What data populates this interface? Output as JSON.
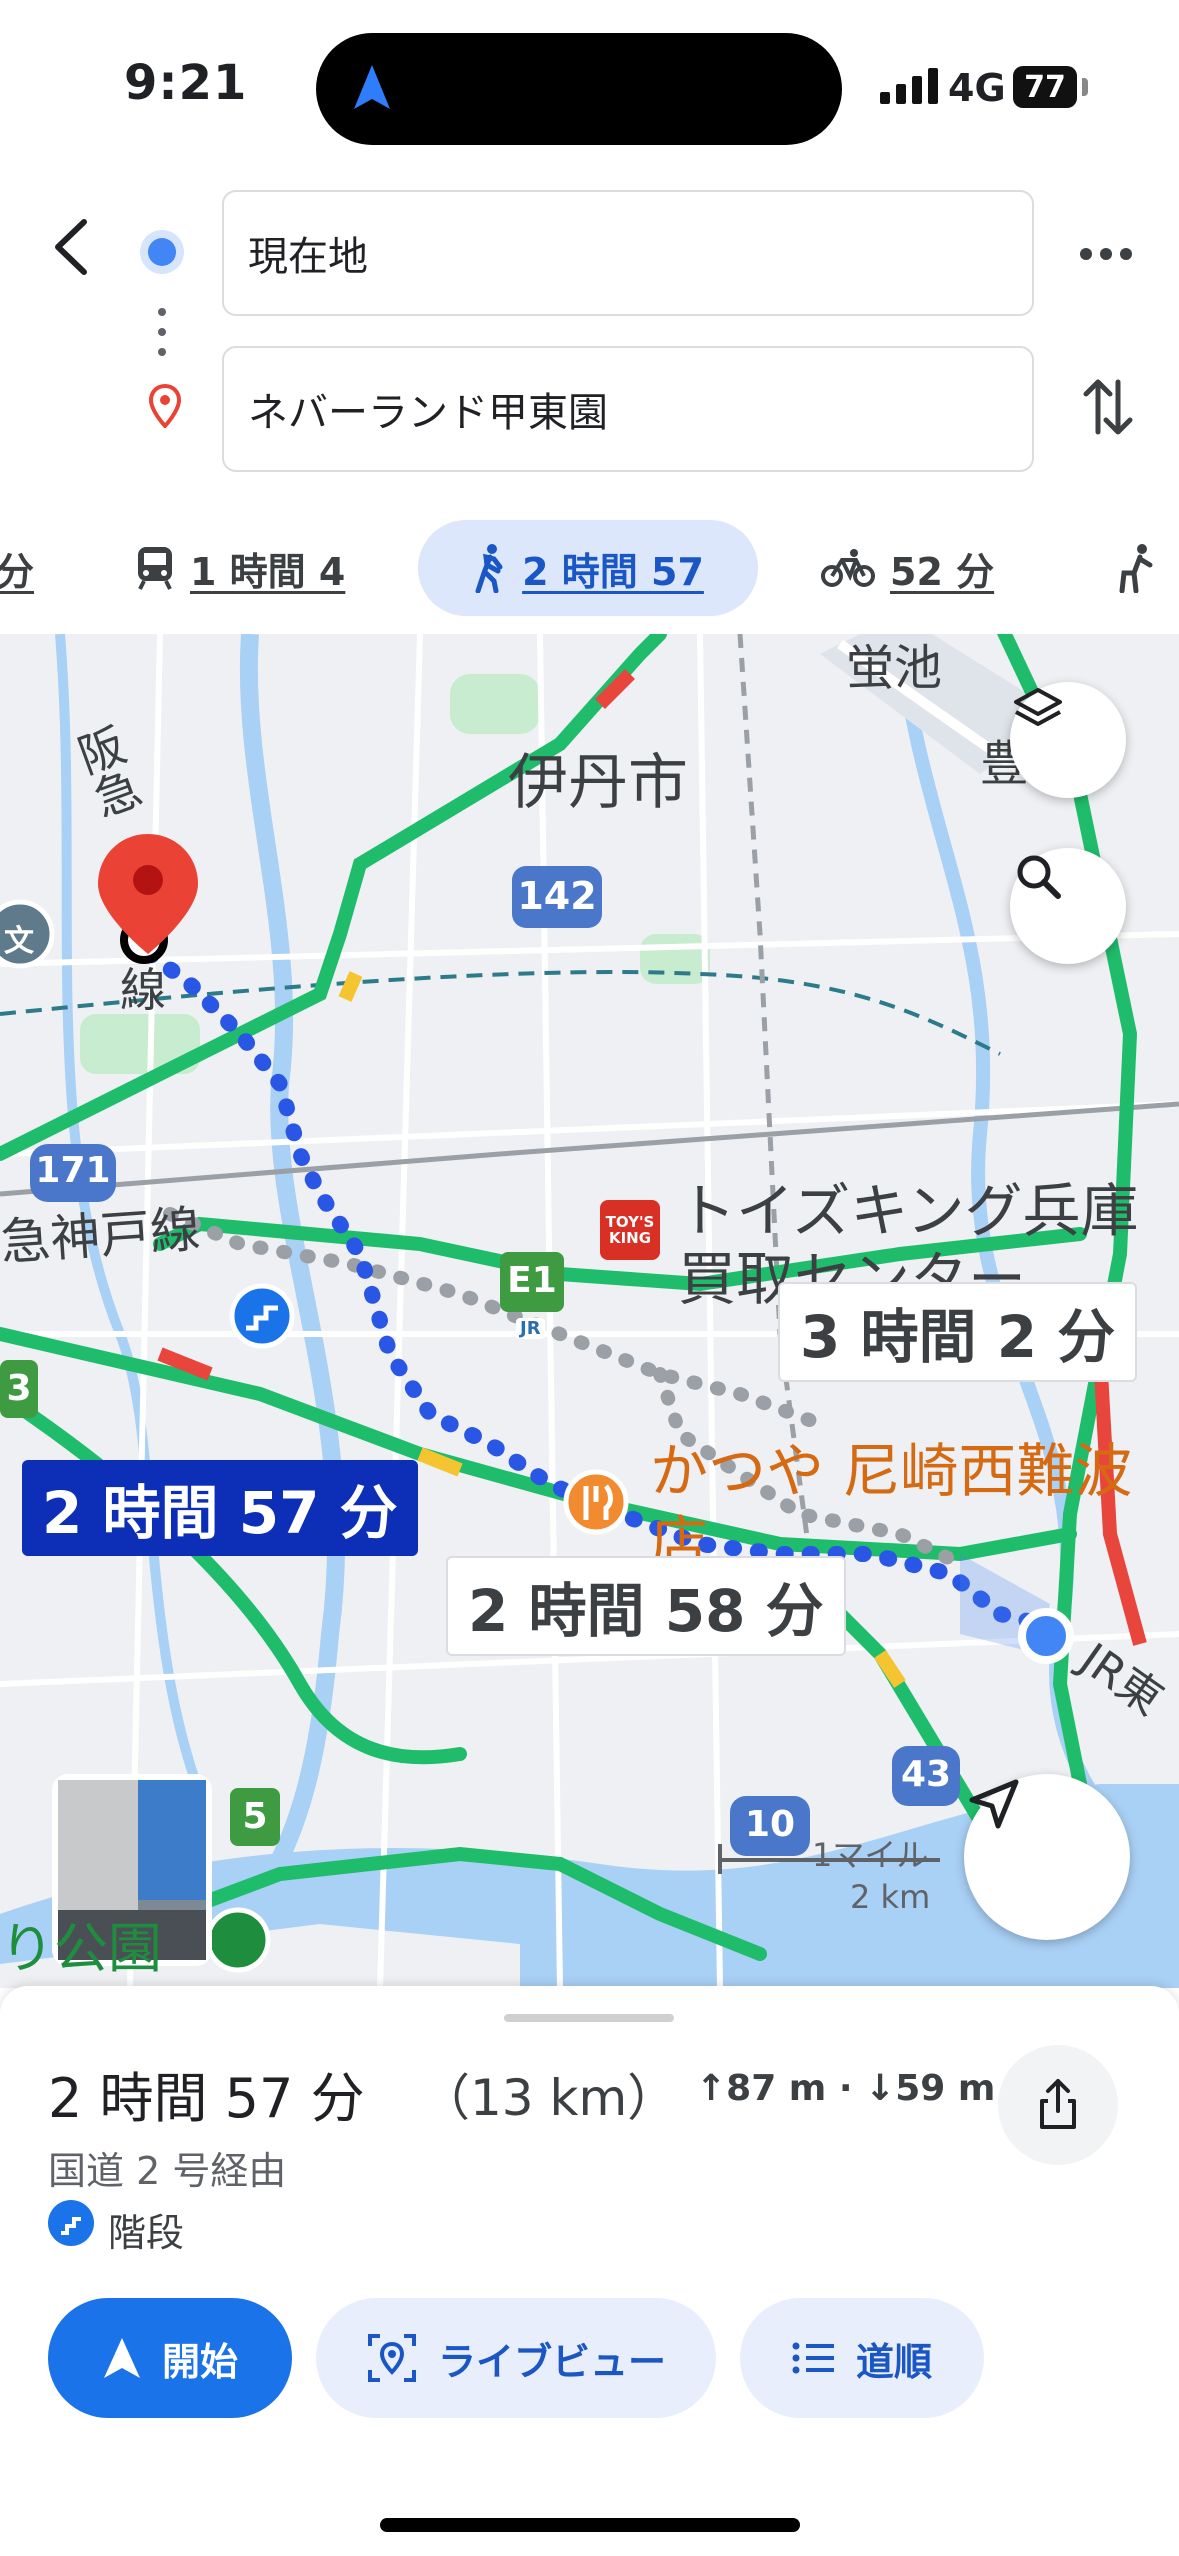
{
  "status": {
    "time": "9:21",
    "network": "4G",
    "battery": "77"
  },
  "header": {
    "origin": "現在地",
    "destination": "ネバーランド甲東園"
  },
  "tabs": [
    {
      "icon": "car-icon",
      "label": "分"
    },
    {
      "icon": "train-icon",
      "label": "1 時間 4"
    },
    {
      "icon": "walk-icon",
      "label": "2 時間 57",
      "selected": true
    },
    {
      "icon": "bike-icon",
      "label": "52 分"
    },
    {
      "icon": "ride-icon",
      "label": ""
    }
  ],
  "map": {
    "labels": {
      "itami": "伊丹市",
      "koike": "蛍池",
      "toyo": "豊",
      "hankyu_line": "阪急",
      "sen": "線",
      "kobe_line": "急神戸線",
      "bun": "文",
      "toys_1": "トイズキング兵庫",
      "toys_2": "買取センター",
      "toys_logo": "TOY'S KING",
      "katsuya_1": "かつや 尼崎西難波",
      "katsuya_2": "店",
      "koen": "り公園",
      "jr_east": "JR東",
      "jr": "JR",
      "scale_mile": "1マイル",
      "scale_km": "2 km"
    },
    "shields": {
      "r142": "142",
      "r171": "171",
      "e1": "E1",
      "r43": "43",
      "r10": "10",
      "r5": "5",
      "r3": "3"
    },
    "routes": {
      "main": "2 時間 57 分",
      "alt1": "3 時間 2 分",
      "alt2": "2 時間 58 分"
    }
  },
  "sheet": {
    "duration": "2 時間 57 分",
    "distance": "（13 km）",
    "elevation": "↑87 m · ↓59 m",
    "via": "国道 2 号経由",
    "stairs": "階段",
    "start": "開始",
    "live_view": "ライブビュー",
    "steps": "道順"
  },
  "colors": {
    "accent": "#1a73e8",
    "route": "#2a56e6",
    "traffic_green": "#1fbd6b"
  }
}
